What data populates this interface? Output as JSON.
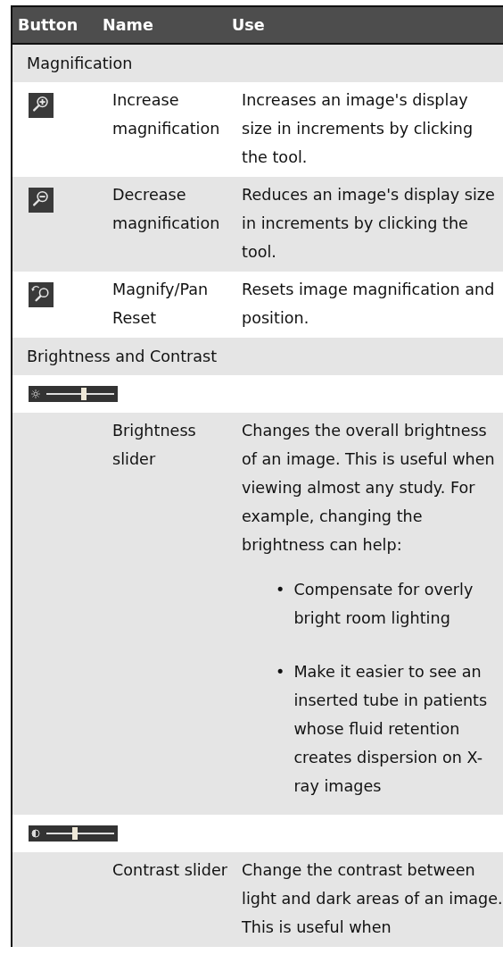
{
  "table": {
    "columns": [
      "Button",
      "Name",
      "Use"
    ],
    "rows": [
      {
        "kind": "section",
        "label": "Magnification"
      },
      {
        "kind": "tool",
        "name": "Increase magnification",
        "use": "Increases an image's display size in increments by clicking the tool."
      },
      {
        "kind": "tool",
        "name": "Decrease magnification",
        "use": "Reduces an image's display size in increments by clicking the tool."
      },
      {
        "kind": "tool",
        "name": "Magnify/Pan Reset",
        "use": "Resets image magnification and position."
      },
      {
        "kind": "section",
        "label": "Brightness and Contrast"
      },
      {
        "kind": "slider",
        "level": 0.55
      },
      {
        "kind": "description",
        "name": "Brightness slider",
        "use": "Changes the overall brightness of an image. This is useful when viewing almost any study. For example, changing the brightness can help:",
        "bullets": [
          {
            "marker": "•",
            "text": "Compensate for overly bright room lighting"
          },
          {
            "marker": "•",
            "text": "Make it easier to see an inserted tube in patients whose fluid retention creates dispersion on X-ray images"
          }
        ]
      },
      {
        "kind": "slider",
        "level": 0.42
      },
      {
        "kind": "description",
        "name": "Contrast slider",
        "use": "Change the contrast between light and dark areas of an image. This is useful when"
      }
    ]
  }
}
